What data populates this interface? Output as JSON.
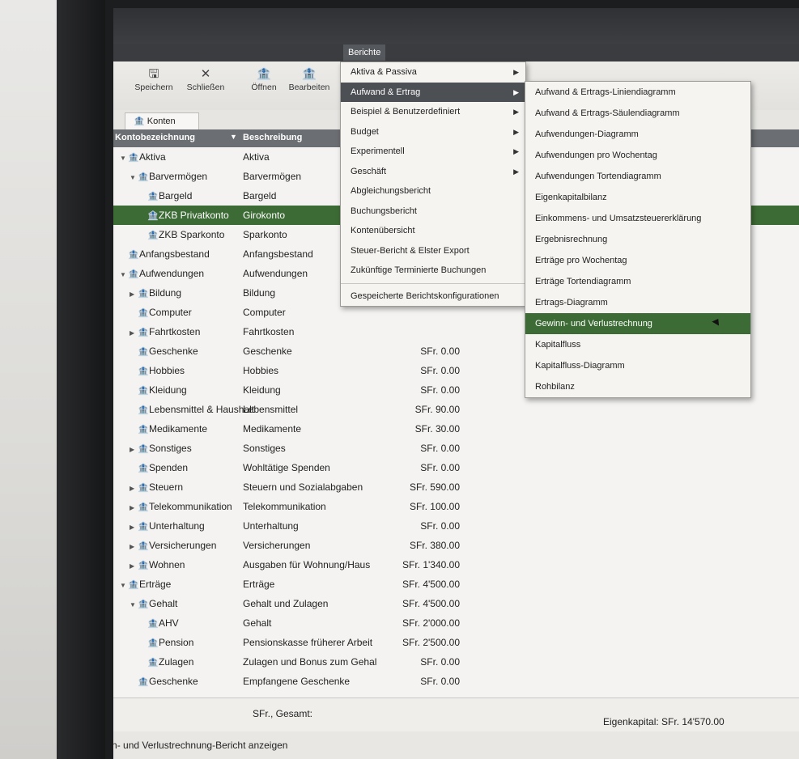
{
  "menubar": {
    "active_menu": "Berichte"
  },
  "toolbar": {
    "buttons": [
      {
        "label": "Speichern",
        "icon": "save-icon",
        "glyph": "🖫"
      },
      {
        "label": "Schließen",
        "icon": "close-icon",
        "glyph": "✕"
      },
      {
        "label": "Öffnen",
        "icon": "open-icon",
        "glyph": "🏦"
      },
      {
        "label": "Bearbeiten",
        "icon": "edit-icon",
        "glyph": "🏦"
      }
    ]
  },
  "tabs": [
    {
      "label": "Konten"
    }
  ],
  "columns": {
    "name": "Kontobezeichnung",
    "desc": "Beschreibung"
  },
  "accounts": [
    {
      "name": "Aktiva",
      "desc": "Aktiva",
      "total": "",
      "level": 1,
      "expander": "▼"
    },
    {
      "name": "Barvermögen",
      "desc": "Barvermögen",
      "total": "",
      "level": 2,
      "expander": "▼"
    },
    {
      "name": "Bargeld",
      "desc": "Bargeld",
      "total": "",
      "level": 3,
      "expander": ""
    },
    {
      "name": "ZKB Privatkonto",
      "desc": "Girokonto",
      "total": "",
      "level": 3,
      "expander": "",
      "selected": true
    },
    {
      "name": "ZKB Sparkonto",
      "desc": "Sparkonto",
      "total": "",
      "level": 3,
      "expander": ""
    },
    {
      "name": "Anfangsbestand",
      "desc": "Anfangsbestand",
      "total": "",
      "level": 1,
      "expander": ""
    },
    {
      "name": "Aufwendungen",
      "desc": "Aufwendungen",
      "total": "",
      "level": 1,
      "expander": "▼"
    },
    {
      "name": "Bildung",
      "desc": "Bildung",
      "total": "",
      "level": 2,
      "expander": "▶"
    },
    {
      "name": "Computer",
      "desc": "Computer",
      "total": "",
      "level": 2,
      "expander": ""
    },
    {
      "name": "Fahrtkosten",
      "desc": "Fahrtkosten",
      "total": "",
      "level": 2,
      "expander": "▶"
    },
    {
      "name": "Geschenke",
      "desc": "Geschenke",
      "total": "SFr. 0.00",
      "level": 2,
      "expander": ""
    },
    {
      "name": "Hobbies",
      "desc": "Hobbies",
      "total": "SFr. 0.00",
      "level": 2,
      "expander": ""
    },
    {
      "name": "Kleidung",
      "desc": "Kleidung",
      "total": "SFr. 0.00",
      "level": 2,
      "expander": ""
    },
    {
      "name": "Lebensmittel & Haushalt",
      "desc": "Lebensmittel",
      "total": "SFr. 90.00",
      "level": 2,
      "expander": ""
    },
    {
      "name": "Medikamente",
      "desc": "Medikamente",
      "total": "SFr. 30.00",
      "level": 2,
      "expander": ""
    },
    {
      "name": "Sonstiges",
      "desc": "Sonstiges",
      "total": "SFr. 0.00",
      "level": 2,
      "expander": "▶"
    },
    {
      "name": "Spenden",
      "desc": "Wohltätige Spenden",
      "total": "SFr. 0.00",
      "level": 2,
      "expander": ""
    },
    {
      "name": "Steuern",
      "desc": "Steuern und Sozialabgaben",
      "total": "SFr. 590.00",
      "level": 2,
      "expander": "▶"
    },
    {
      "name": "Telekommunikation",
      "desc": "Telekommunikation",
      "total": "SFr. 100.00",
      "level": 2,
      "expander": "▶"
    },
    {
      "name": "Unterhaltung",
      "desc": "Unterhaltung",
      "total": "SFr. 0.00",
      "level": 2,
      "expander": "▶"
    },
    {
      "name": "Versicherungen",
      "desc": "Versicherungen",
      "total": "SFr. 380.00",
      "level": 2,
      "expander": "▶"
    },
    {
      "name": "Wohnen",
      "desc": "Ausgaben für Wohnung/Haus",
      "total": "SFr. 1'340.00",
      "level": 2,
      "expander": "▶"
    },
    {
      "name": "Erträge",
      "desc": "Erträge",
      "total": "SFr. 4'500.00",
      "level": 1,
      "expander": "▼"
    },
    {
      "name": "Gehalt",
      "desc": "Gehalt und Zulagen",
      "total": "SFr. 4'500.00",
      "level": 2,
      "expander": "▼"
    },
    {
      "name": "AHV",
      "desc": "Gehalt",
      "total": "SFr. 2'000.00",
      "level": 3,
      "expander": ""
    },
    {
      "name": "Pension",
      "desc": "Pensionskasse früherer Arbeit",
      "total": "SFr. 2'500.00",
      "level": 3,
      "expander": ""
    },
    {
      "name": "Zulagen",
      "desc": "Zulagen und Bonus zum Gehal",
      "total": "SFr. 0.00",
      "level": 3,
      "expander": ""
    },
    {
      "name": "Geschenke",
      "desc": "Empfangene Geschenke",
      "total": "SFr. 0.00",
      "level": 2,
      "expander": ""
    }
  ],
  "summary": {
    "label": "SFr., Gesamt:",
    "equity": "Eigenkapital: SFr. 14'570.00"
  },
  "statusbar": "Gewinn- und Verlustrechnung-Bericht anzeigen",
  "berichte_menu": [
    {
      "label": "Aktiva & Passiva",
      "submenu": true
    },
    {
      "label": "Aufwand & Ertrag",
      "submenu": true,
      "active": true
    },
    {
      "label": "Beispiel & Benutzerdefiniert",
      "submenu": true
    },
    {
      "label": "Budget",
      "submenu": true
    },
    {
      "label": "Experimentell",
      "submenu": true
    },
    {
      "label": "Geschäft",
      "submenu": true
    },
    {
      "label": "Abgleichungsbericht",
      "submenu": false
    },
    {
      "label": "Buchungsbericht",
      "submenu": false
    },
    {
      "label": "Kontenübersicht",
      "submenu": false
    },
    {
      "label": "Steuer-Bericht & Elster Export",
      "submenu": false
    },
    {
      "label": "Zukünftige Terminierte Buchungen",
      "submenu": false
    },
    {
      "label": "Gespeicherte Berichtskonfigurationen",
      "submenu": false,
      "separator_before": true
    }
  ],
  "submenu": [
    {
      "label": "Aufwand & Ertrags-Liniendiagramm"
    },
    {
      "label": "Aufwand & Ertrags-Säulendiagramm"
    },
    {
      "label": "Aufwendungen-Diagramm"
    },
    {
      "label": "Aufwendungen pro Wochentag"
    },
    {
      "label": "Aufwendungen Tortendiagramm"
    },
    {
      "label": "Eigenkapitalbilanz"
    },
    {
      "label": "Einkommens- und Umsatzsteuererklärung"
    },
    {
      "label": "Ergebnisrechnung"
    },
    {
      "label": "Erträge pro Wochentag"
    },
    {
      "label": "Erträge Tortendiagramm"
    },
    {
      "label": "Ertrags-Diagramm"
    },
    {
      "label": "Gewinn- und Verlustrechnung",
      "highlighted": true
    },
    {
      "label": "Kapitalfluss"
    },
    {
      "label": "Kapitalfluss-Diagramm"
    },
    {
      "label": "Rohbilanz"
    }
  ],
  "colors": {
    "selection": "#3d6b35",
    "menu_active": "#4c4f53",
    "header": "#6b6e72"
  }
}
